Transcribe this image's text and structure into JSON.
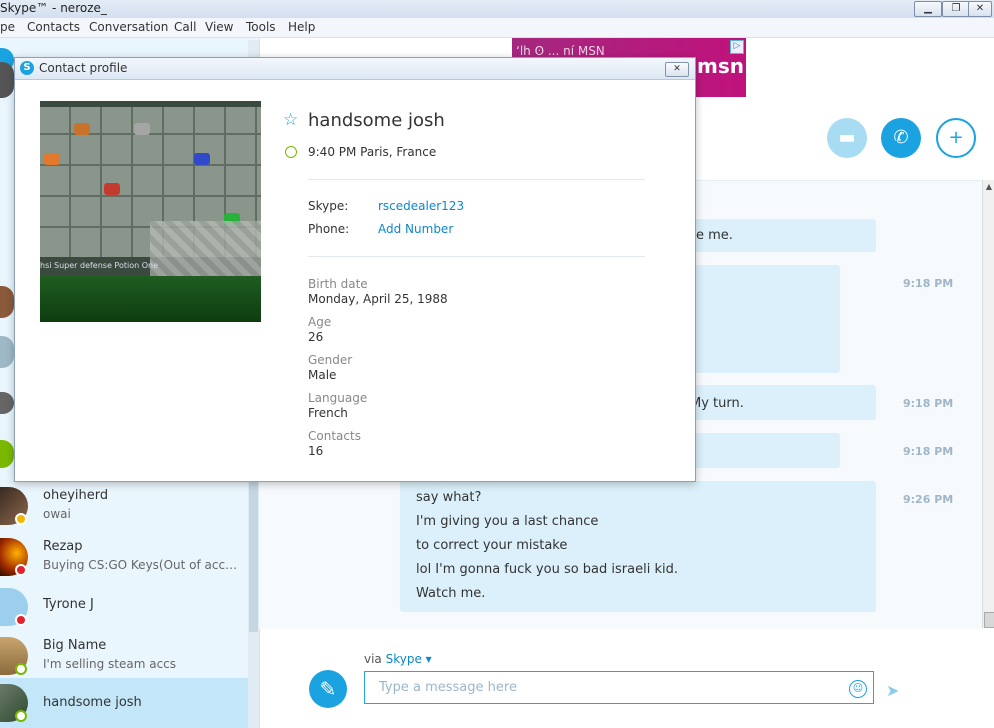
{
  "window": {
    "title": "Skype™ - neroze_",
    "controls": [
      "minimize",
      "maximize",
      "close"
    ]
  },
  "menu": [
    "pe",
    "Contacts",
    "Conversation",
    "Call",
    "View",
    "Tools",
    "Help"
  ],
  "ad": {
    "text": "ʻlh ʘ ... ní MSN",
    "brand": "msn",
    "adchoice": "▷"
  },
  "contacts": [
    {
      "name": "oheyiherd",
      "mood": "owai",
      "status": "away",
      "status_color": "#f4b400"
    },
    {
      "name": "Rezap",
      "mood": "Buying CS:GO Keys(Out of accoun...",
      "status": "busy",
      "status_color": "#e3202d"
    },
    {
      "name": "Tyrone J",
      "mood": "",
      "status": "busy",
      "status_color": "#e3202d"
    },
    {
      "name": "Big Name",
      "mood": "I'm selling steam accs",
      "status": "online",
      "status_color": "#7ab800"
    },
    {
      "name": "handsome josh",
      "mood": "",
      "status": "online",
      "status_color": "#7ab800"
    }
  ],
  "chat": {
    "messages": [
      {
        "text": "ee me.",
        "time": "9:18 PM"
      },
      {
        "text": "",
        "time": "9:18 PM"
      },
      {
        "text": "My turn.",
        "time": "9:18 PM"
      },
      {
        "text": "",
        "time": "9:18 PM"
      },
      {
        "lines": [
          "say what?",
          "I'm giving you a last chance",
          "to correct your mistake",
          "lol I'm gonna fuck you so bad israeli kid.",
          "Watch me."
        ],
        "time": "9:26 PM"
      }
    ],
    "via_label": "via",
    "via_service": "Skype ▾",
    "input_placeholder": "Type a message here"
  },
  "dialog": {
    "title": "Contact profile",
    "close": "✕",
    "name": "handsome josh",
    "local_time": "9:40 PM Paris, France",
    "skype_label": "Skype:",
    "skype_value": "rscedealer123",
    "phone_label": "Phone:",
    "phone_value": "Add Number",
    "details": [
      {
        "label": "Birth date",
        "value": "Monday, April 25, 1988"
      },
      {
        "label": "Age",
        "value": "26"
      },
      {
        "label": "Gender",
        "value": "Male"
      },
      {
        "label": "Language",
        "value": "French"
      },
      {
        "label": "Contacts",
        "value": "16"
      }
    ],
    "picture_caption": "hsi Super defense Potion      One"
  },
  "colors": {
    "accent": "#1ba2e0",
    "bubble": "#dbf0fb",
    "selected_contact": "#c3e7f8"
  }
}
